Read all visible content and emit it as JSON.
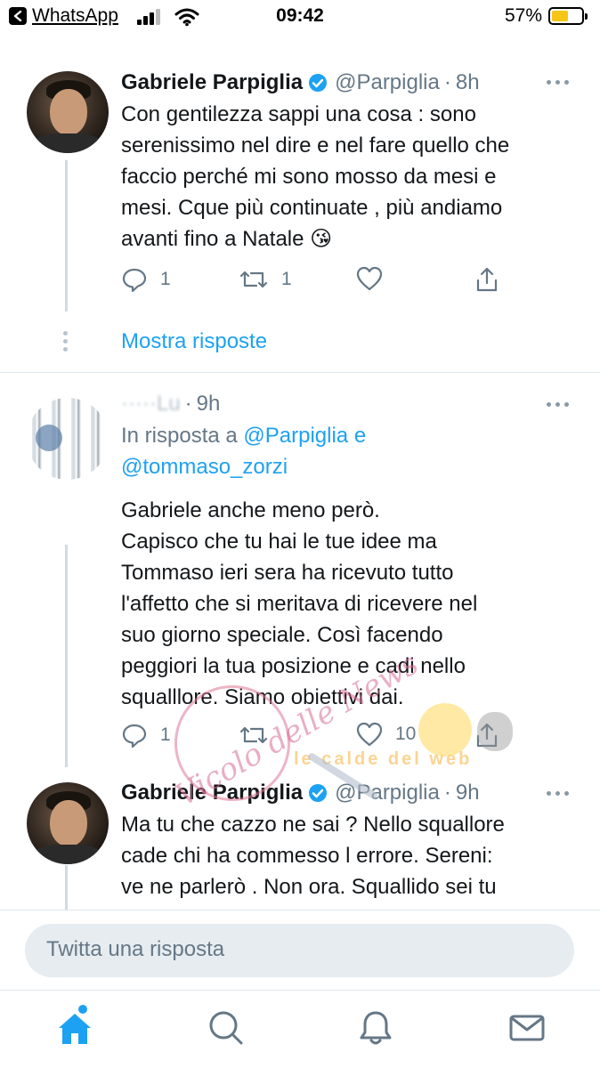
{
  "status_bar": {
    "back_app": "WhatsApp",
    "time": "09:42",
    "battery_pct": "57%",
    "battery_level": 0.57
  },
  "tweets": [
    {
      "name": "Gabriele Parpiglia",
      "handle": "@Parpiglia",
      "time": "8h",
      "verified": true,
      "text": "Con gentilezza sappi una cosa : sono\nserenissimo nel dire e nel fare quello che\nfaccio perché mi sono mosso da mesi e\nmesi. Cque più continuate , più andiamo\navanti fino a Natale 😘",
      "replies": "1",
      "retweets": "1",
      "likes": ""
    },
    {
      "name": "",
      "handle": "·····Lu",
      "time": "9h",
      "reply_prefix": "In risposta a",
      "reply_mention_1": "@Parpiglia",
      "reply_join": "e",
      "reply_mention_2": "@tommaso_zorzi",
      "text": "Gabriele anche meno però.\nCapisco che tu hai le tue idee ma\nTommaso ieri sera ha ricevuto tutto\nl'affetto che si meritava di ricevere nel\nsuo giorno speciale. Così facendo\npeggiori la tua posizione e cadi nello\nsqualllore. Siamo obiettivi dai.",
      "replies": "1",
      "retweets": "",
      "likes": "10"
    },
    {
      "name": "Gabriele Parpiglia",
      "handle": "@Parpiglia",
      "time": "9h",
      "verified": true,
      "text": "Ma tu che cazzo ne sai ? Nello squallore\ncade chi ha commesso l errore. Sereni:\nve ne parlerò . Non ora. Squallido sei tu"
    }
  ],
  "show_replies": "Mostra risposte",
  "compose": {
    "placeholder": "Twitta una risposta"
  },
  "watermark": {
    "script": "Vicolo delle News",
    "band": "le calde del web"
  },
  "tabs": [
    "home",
    "search",
    "notifications",
    "messages"
  ],
  "colors": {
    "accent": "#1da1f2",
    "muted": "#657786",
    "text": "#14171a",
    "line": "#d2dbe2"
  }
}
